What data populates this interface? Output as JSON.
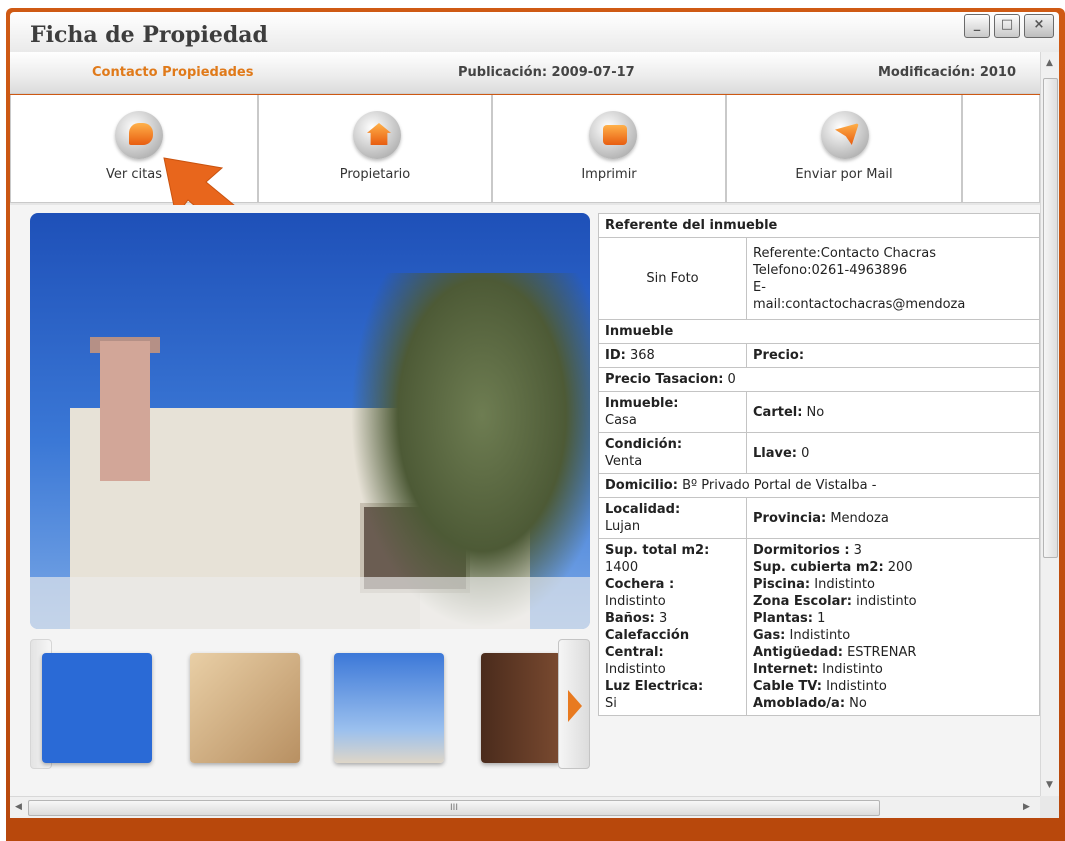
{
  "window": {
    "title": "Ficha de Propiedad",
    "controls": {
      "minimize": "_",
      "maximize": "□",
      "close": "×"
    }
  },
  "infobar": {
    "contact": "Contacto Propiedades",
    "publicacion": "Publicación: 2009-07-17",
    "modificacion": "Modificación: 2010"
  },
  "toolbar": {
    "items": [
      {
        "label": "Ver citas",
        "icon": "chat-bubble-icon"
      },
      {
        "label": "Propietario",
        "icon": "house-icon"
      },
      {
        "label": "Imprimir",
        "icon": "printer-icon"
      },
      {
        "label": "Enviar por Mail",
        "icon": "mail-check-icon"
      }
    ]
  },
  "details": {
    "referente_header": "Referente del inmueble",
    "sin_foto": "Sin Foto",
    "referente": "Referente:Contacto Chacras",
    "telefono": "Telefono:0261-4963896",
    "email_prefix": "E-",
    "email": "mail:contactochacras@mendoza",
    "inmueble_header": "Inmueble",
    "id_label": "ID:",
    "id_value": " 368",
    "precio_label": "Precio:",
    "precio_tasacion_label": "Precio Tasacion:",
    "precio_tasacion_value": " 0",
    "inmueble_label": "Inmueble:",
    "inmueble_value": "Casa",
    "cartel_label": "Cartel:",
    "cartel_value": " No",
    "condicion_label": "Condición:",
    "condicion_value": "Venta",
    "llave_label": "Llave:",
    "llave_value": " 0",
    "domicilio_label": "Domicilio:",
    "domicilio_value": " Bº Privado Portal de Vistalba -",
    "localidad_label": "Localidad:",
    "localidad_value": "Lujan",
    "provincia_label": "Provincia:",
    "provincia_value": " Mendoza",
    "left_features": [
      {
        "label": "Sup. total m2:",
        "value": "1400"
      },
      {
        "label": "Cochera :",
        "value": "Indistinto"
      },
      {
        "label": "Baños:",
        "value": " 3"
      },
      {
        "label": "Calefacción Central:",
        "value": "Indistinto"
      },
      {
        "label": "Luz Electrica:",
        "value": "Si"
      }
    ],
    "right_features": [
      {
        "label": "Dormitorios :",
        "value": " 3"
      },
      {
        "label": "Sup. cubierta m2:",
        "value": " 200"
      },
      {
        "label": "Piscina:",
        "value": " Indistinto"
      },
      {
        "label": "Zona Escolar:",
        "value": " indistinto"
      },
      {
        "label": "Plantas:",
        "value": " 1"
      },
      {
        "label": "Gas:",
        "value": " Indistinto"
      },
      {
        "label": "Antigüedad:",
        "value": " ESTRENAR"
      },
      {
        "label": "Internet:",
        "value": " Indistinto"
      },
      {
        "label": "Cable TV:",
        "value": " Indistinto"
      },
      {
        "label": "Amoblado/a:",
        "value": " No"
      }
    ]
  },
  "scrollbar": {
    "h_thumb_grip": "III"
  },
  "colors": {
    "accent": "#e07a1a",
    "frame": "#c9530f",
    "arrow": "#e8661c"
  }
}
